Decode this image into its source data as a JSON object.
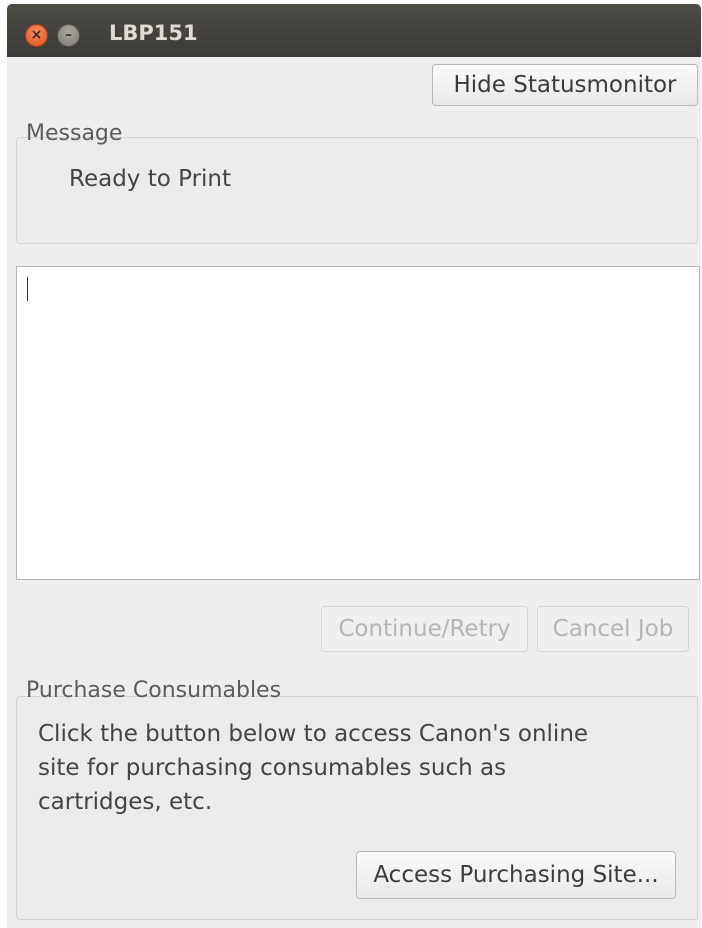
{
  "window": {
    "title": "LBP151",
    "close_glyph": "×",
    "minimize_glyph": "–"
  },
  "toolbar": {
    "hide_statusmonitor_label": "Hide Statusmonitor"
  },
  "message_group": {
    "label": "Message",
    "status_text": "Ready to Print"
  },
  "details": {
    "text": ""
  },
  "job_buttons": {
    "continue_retry_label": "Continue/Retry",
    "cancel_job_label": "Cancel Job"
  },
  "purchase_group": {
    "label": "Purchase Consumables",
    "lines": [
      "Click the button below to access Canon's online",
      "site for purchasing consumables such as",
      "cartridges, etc."
    ],
    "access_button_label": "Access Purchasing Site..."
  },
  "icons": {
    "close": "close-icon",
    "minimize": "minimize-icon"
  },
  "colors": {
    "titlebar": "#3b3a36",
    "window_background": "#efeeed",
    "close_button": "#e15421",
    "disabled_text": "#b6b5b2"
  }
}
